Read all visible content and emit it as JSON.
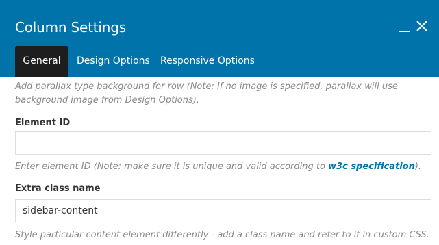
{
  "header": {
    "title": "Column Settings",
    "background": "#0073aa",
    "minimize_icon": "minimize-icon",
    "close_icon": "close-icon"
  },
  "tabs": [
    {
      "label": "General",
      "active": true
    },
    {
      "label": "Design Options",
      "active": false
    },
    {
      "label": "Responsive Options",
      "active": false
    }
  ],
  "parallax_help": "Add parallax type background for row (Note: If no image is specified, parallax will use background image from Design Options).",
  "element_id": {
    "label": "Element ID",
    "value": "",
    "help_prefix": "Enter element ID (Note: make sure it is unique and valid according to ",
    "help_link": "w3c specification",
    "help_suffix": ")."
  },
  "extra_class": {
    "label": "Extra class name",
    "value": "sidebar-content",
    "help": "Style particular content element differently - add a class name and refer to it in custom CSS."
  },
  "colors": {
    "link": "#0073aa",
    "active_tab": "#1e1e1e",
    "help_text": "#8a8a8a"
  }
}
